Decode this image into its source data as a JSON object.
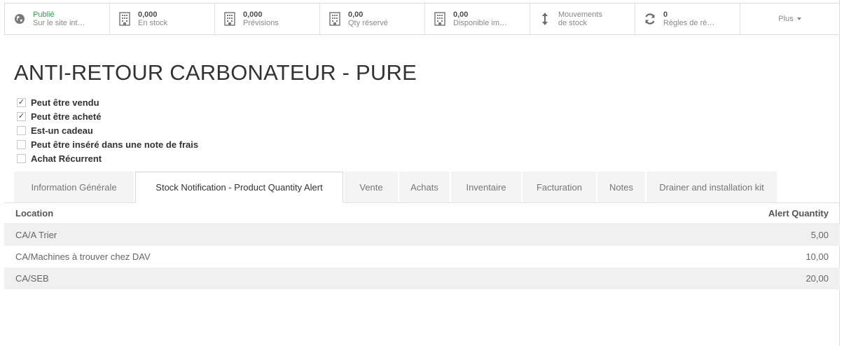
{
  "smart_buttons": [
    {
      "icon": "globe-icon",
      "value": "Publié",
      "label": "Sur le site int…",
      "value_color": "#28a745"
    },
    {
      "icon": "building-icon",
      "value": "0,000",
      "label": "En stock"
    },
    {
      "icon": "building-icon",
      "value": "0,000",
      "label": "Prévisions"
    },
    {
      "icon": "building-icon",
      "value": "0,00",
      "label": "Qty réservé"
    },
    {
      "icon": "building-icon",
      "value": "0,00",
      "label": "Disponible im…"
    },
    {
      "icon": "vertical-arrows-icon",
      "line1": "Mouvements",
      "line2": "de stock"
    },
    {
      "icon": "refresh-icon",
      "value": "0",
      "label": "Règles de ré…"
    }
  ],
  "more_label": "Plus",
  "product_title": "ANTI-RETOUR CARBONATEUR - PURE",
  "checkboxes": [
    {
      "label": "Peut être vendu",
      "checked": true
    },
    {
      "label": "Peut être acheté",
      "checked": true
    },
    {
      "label": "Est-un cadeau",
      "checked": false
    },
    {
      "label": "Peut être inséré dans une note de frais",
      "checked": false
    },
    {
      "label": "Achat Récurrent",
      "checked": false
    }
  ],
  "tabs": [
    {
      "label": "Information Générale"
    },
    {
      "label": "Stock Notification - Product Quantity Alert",
      "active": true
    },
    {
      "label": "Vente"
    },
    {
      "label": "Achats"
    },
    {
      "label": "Inventaire"
    },
    {
      "label": "Facturation"
    },
    {
      "label": "Notes"
    },
    {
      "label": "Drainer and installation kit"
    }
  ],
  "table": {
    "headers": {
      "location": "Location",
      "alert_quantity": "Alert Quantity"
    },
    "rows": [
      {
        "location": "CA/A Trier",
        "quantity": "5,00"
      },
      {
        "location": "CA/Machines à trouver chez DAV",
        "quantity": "10,00"
      },
      {
        "location": "CA/SEB",
        "quantity": "20,00"
      }
    ]
  }
}
